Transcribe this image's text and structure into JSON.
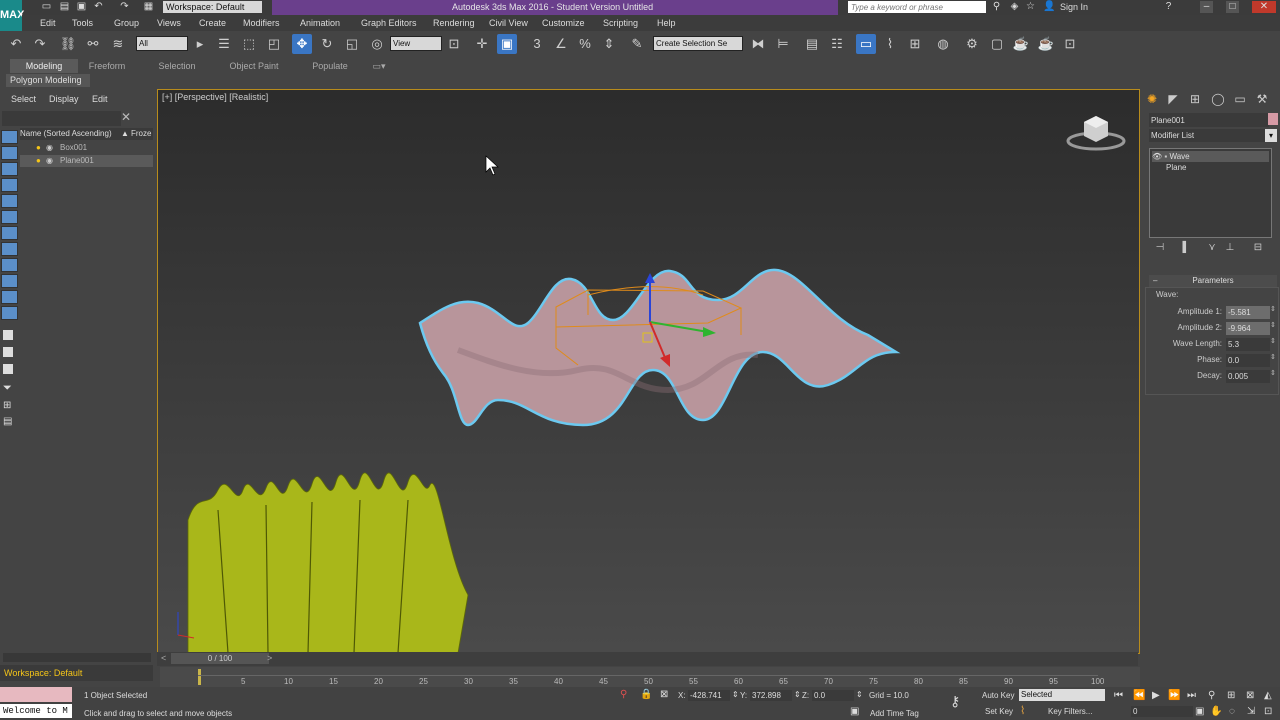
{
  "titlebar": {
    "app_logo": "MAX",
    "workspace": "Workspace: Default",
    "title": "Autodesk 3ds Max 2016 - Student Version    Untitled",
    "search_placeholder": "Type a keyword or phrase",
    "sign_in": "Sign In"
  },
  "menu": [
    "Edit",
    "Tools",
    "Group",
    "Views",
    "Create",
    "Modifiers",
    "Animation",
    "Graph Editors",
    "Rendering",
    "Civil View",
    "Customize",
    "Scripting",
    "Help"
  ],
  "toolbar": {
    "selection_filter": "All",
    "ref_coord": "View",
    "named_selection": "Create Selection Se"
  },
  "ribbon": {
    "tabs": [
      "Modeling",
      "Freeform",
      "Selection",
      "Object Paint",
      "Populate"
    ],
    "sub_label": "Polygon Modeling"
  },
  "scene_explorer": {
    "tabs": [
      "Select",
      "Display",
      "Edit"
    ],
    "col_name": "Name (Sorted Ascending)",
    "col_frozen": "Froze",
    "items": [
      "Box001",
      "Plane001"
    ],
    "workspace": "Workspace: Default"
  },
  "viewport": {
    "label": "[+] [Perspective] [Realistic]"
  },
  "command_panel": {
    "object_name": "Plane001",
    "modifier_list": "Modifier List",
    "stack": [
      "Wave",
      "Plane"
    ],
    "params_title": "Parameters",
    "group_label": "Wave:",
    "params": [
      {
        "label": "Amplitude 1:",
        "value": "-5.581"
      },
      {
        "label": "Amplitude 2:",
        "value": "-9.964"
      },
      {
        "label": "Wave Length:",
        "value": "5.3"
      },
      {
        "label": "Phase:",
        "value": "0.0"
      },
      {
        "label": "Decay:",
        "value": "0.005"
      }
    ],
    "colors": {
      "object": "#d69aa5"
    }
  },
  "timeline": {
    "frame": "0 / 100",
    "ticks": [
      "5",
      "10",
      "15",
      "20",
      "25",
      "30",
      "35",
      "40",
      "45",
      "50",
      "55",
      "60",
      "65",
      "70",
      "75",
      "80",
      "85",
      "90",
      "95",
      "100"
    ]
  },
  "status": {
    "console": "Welcome to M",
    "selected": "1 Object Selected",
    "prompt": "Click and drag to select and move objects",
    "x_label": "X:",
    "x": "-428.741",
    "y_label": "Y:",
    "y": "372.898",
    "z_label": "Z:",
    "z": "0.0",
    "grid": "Grid = 10.0",
    "add_time_tag": "Add Time Tag",
    "auto_key": "Auto Key",
    "set_key": "Set Key",
    "key_mode": "Selected",
    "key_filters": "Key Filters...",
    "frame": "0"
  }
}
